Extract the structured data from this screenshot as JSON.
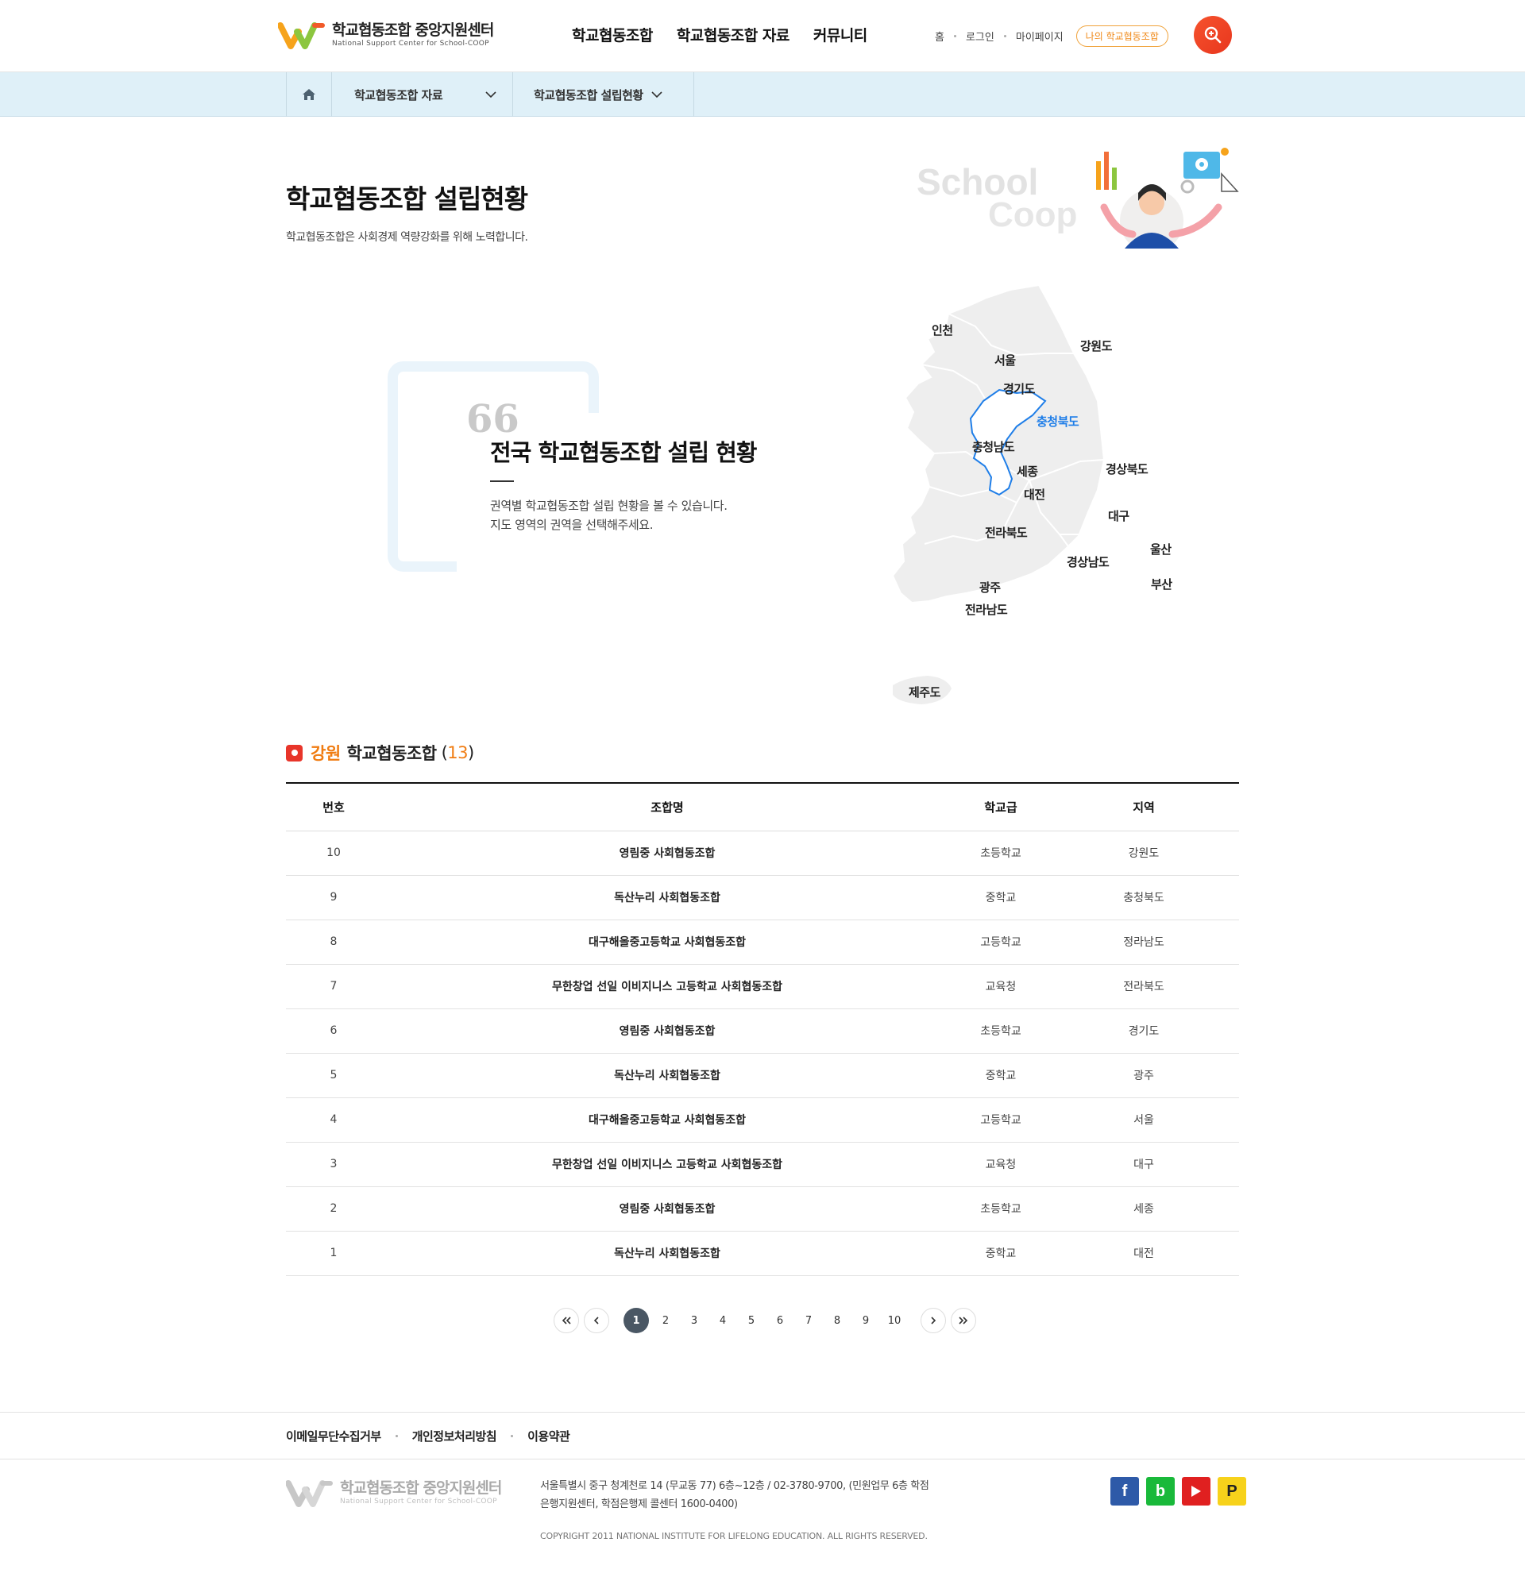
{
  "header": {
    "logo_title": "학교협동조합 중앙지원센터",
    "logo_sub": "National Support Center for School-COOP",
    "gnb": [
      "학교협동조합",
      "학교협동조합 자료",
      "커뮤니티"
    ],
    "util": {
      "home": "홈",
      "login": "로그인",
      "mypage": "마이페이지",
      "my_coop": "나의 학교협동조합"
    }
  },
  "breadcrumb": {
    "level1": "학교협동조합 자료",
    "level2": "학교협동조합 설립현황"
  },
  "page": {
    "title": "학교협동조합 설립현황",
    "subtitle": "학교협동조합은 사회경제 역량강화를 위해 노력합니다.",
    "illust_text_1": "School",
    "illust_text_2": "Coop"
  },
  "intro": {
    "quote": "66",
    "title": "전국 학교협동조합 설립 현황",
    "desc_line1": "권역별 학교협동조합 설립 현황을 볼 수 있습니다.",
    "desc_line2": "지도 영역의 권역을 선택해주세요."
  },
  "map": {
    "active_region": "충청북도",
    "regions": {
      "incheon": "인천",
      "seoul": "서울",
      "gangwon": "강원도",
      "gyeonggi": "경기도",
      "chungbuk": "충청북도",
      "chungnam": "충청남도",
      "sejong": "세종",
      "daejeon": "대전",
      "gyeongbuk": "경상북도",
      "daegu": "대구",
      "jeonbuk": "전라북도",
      "ulsan": "울산",
      "gyeongnam": "경상남도",
      "gwangju": "광주",
      "busan": "부산",
      "jeonnam": "전라남도",
      "jeju": "제주도"
    }
  },
  "list": {
    "region": "강원",
    "label": "학교협동조합",
    "count_open": "(",
    "count": "13",
    "count_close": ")",
    "columns": [
      "번호",
      "조합명",
      "학교급",
      "지역"
    ],
    "rows": [
      {
        "no": "10",
        "name": "영림중 사회협동조합",
        "level": "초등학교",
        "area": "강원도"
      },
      {
        "no": "9",
        "name": "독산누리 사회협동조합",
        "level": "중학교",
        "area": "충청북도"
      },
      {
        "no": "8",
        "name": "대구해올중고등학교 사회협동조합",
        "level": "고등학교",
        "area": "정라남도"
      },
      {
        "no": "7",
        "name": "무한창업 선일 이비지니스 고등학교 사회협동조합",
        "level": "교육청",
        "area": "전라북도"
      },
      {
        "no": "6",
        "name": "영림중 사회협동조합",
        "level": "초등학교",
        "area": "경기도"
      },
      {
        "no": "5",
        "name": "독산누리 사회협동조합",
        "level": "중학교",
        "area": "광주"
      },
      {
        "no": "4",
        "name": "대구해올중고등학교 사회협동조합",
        "level": "고등학교",
        "area": "서울"
      },
      {
        "no": "3",
        "name": "무한창업 선일 이비지니스 고등학교 사회협동조합",
        "level": "교육청",
        "area": "대구"
      },
      {
        "no": "2",
        "name": "영림중 사회협동조합",
        "level": "초등학교",
        "area": "세종"
      },
      {
        "no": "1",
        "name": "독산누리 사회협동조합",
        "level": "중학교",
        "area": "대전"
      }
    ]
  },
  "pagination": {
    "current": "1",
    "pages": [
      "1",
      "2",
      "3",
      "4",
      "5",
      "6",
      "7",
      "8",
      "9",
      "10"
    ]
  },
  "footer": {
    "links": [
      "이메일무단수집거부",
      "개인정보처리방침",
      "이용약관"
    ],
    "logo_title": "학교협동조합 중앙지원센터",
    "logo_sub": "National Support Center for School-COOP",
    "addr_line1": "서울특별시 중구 청계천로 14 (무교동 77) 6층~12층 / 02-3780-9700, (민원업무 6층 학점",
    "addr_line2": "은행지원센터, 학점은행제 콜센터 1600-0400)",
    "copyright": "COPYRIGHT 2011 NATIONAL INSTITUTE FOR LIFELONG EDUCATION. ALL RIGHTS RESERVED.",
    "sns": {
      "facebook": "f",
      "blog": "b",
      "post": "P"
    }
  },
  "colors": {
    "accent": "#f07c12",
    "active_map": "#1f7ee8",
    "search": "#e8361e",
    "paging_on": "#4a5764"
  }
}
